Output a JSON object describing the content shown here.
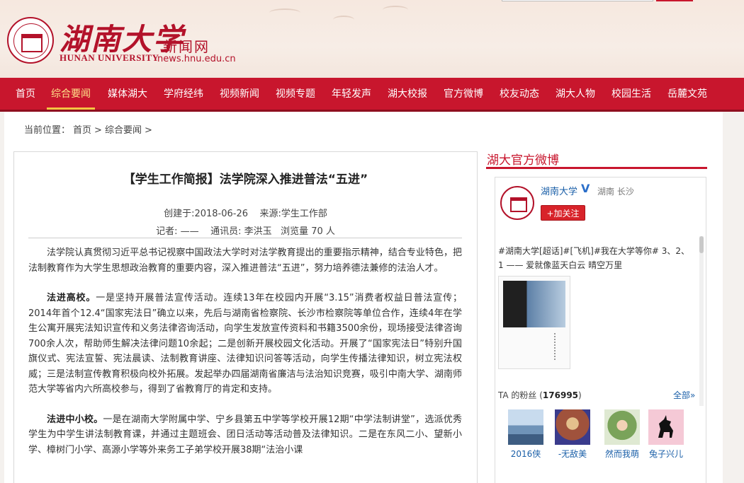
{
  "header": {
    "logo_cn": "湖南大学",
    "logo_en": "HUNAN UNIVERSITY",
    "site_name": "新闻网",
    "site_url": "news.hnu.edu.cn"
  },
  "nav": {
    "items": [
      "首页",
      "综合要闻",
      "媒体湖大",
      "学府经纬",
      "视频新闻",
      "视频专题",
      "年轻发声",
      "湖大校报",
      "官方微博",
      "校友动态",
      "湖大人物",
      "校园生活",
      "岳麓文苑"
    ],
    "active": "综合要闻"
  },
  "breadcrumb": {
    "label": "当前位置：",
    "home": "首页",
    "sep1": ">",
    "section": "综合要闻",
    "sep2": ">"
  },
  "article": {
    "title": "【学生工作简报】法学院深入推进普法“五进”",
    "created": "创建于:2018-06-26",
    "source": "来源:学生工作部",
    "reporter": "记者: ——",
    "correspondent": "通讯员: 李洪玉",
    "views": "浏览量 70 人",
    "p1": "法学院认真贯彻习近平总书记视察中国政法大学时对法学教育提出的重要指示精神，结合专业特色，把法制教育作为大学生思想政治教育的重要内容，深入推进普法“五进”，努力培养德法兼修的法治人才。",
    "p2_head": "法进高校。",
    "p2": "一是坚持开展普法宣传活动。连续13年在校园内开展“3.15”消费者权益日普法宣传；2014年首个12.4“国家宪法日”确立以来，先后与湖南省检察院、长沙市检察院等单位合作，连续4年在学生公寓开展宪法知识宣传和义务法律咨询活动，向学生发放宣传资料和书籍3500余份，现场接受法律咨询700余人次，帮助师生解决法律问题10余起；二是创新开展校园文化活动。开展了“国家宪法日”特别升国旗仪式、宪法宣誓、宪法晨读、法制教育讲座、法律知识问答等活动，向学生传播法律知识，树立宪法权威；三是法制宣传教育积极向校外拓展。发起举办四届湖南省廉洁与法治知识竞赛，吸引中南大学、湖南师范大学等省内六所高校参与，得到了省教育厅的肯定和支持。",
    "p3_head": "法进中小校。",
    "p3": "一是在湖南大学附属中学、宁乡县第五中学等学校开展12期“中学法制讲堂”，选派优秀学生为中学生讲法制教育课，并通过主题班会、团日活动等活动普及法律知识。二是在东风二小、望新小学、樟树门小学、高源小学等外来务工子弟学校开展38期“法治小课"
  },
  "sidebar": {
    "title": "湖大官方微博",
    "weibo_name": "湖南大学",
    "verified": "V",
    "location": "湖南 长沙",
    "follow_label": "+加关注",
    "post_text": "#湖南大学[超话]#[飞机]#我在大学等你# 3、2、1 —— 爱就像蓝天白云 晴空万里",
    "fans_prefix": "TA 的粉丝 (",
    "fans_count": "176995",
    "fans_suffix": ")",
    "all_link": "全部»",
    "fans": [
      {
        "name": "2016侠",
        "color": "#6f93b8"
      },
      {
        "name": "-无敌美",
        "color": "#a0523c"
      },
      {
        "name": "然而我萌",
        "color": "#7aa35a"
      },
      {
        "name": "兔子兴儿",
        "color": "#f5c9d6"
      }
    ]
  }
}
